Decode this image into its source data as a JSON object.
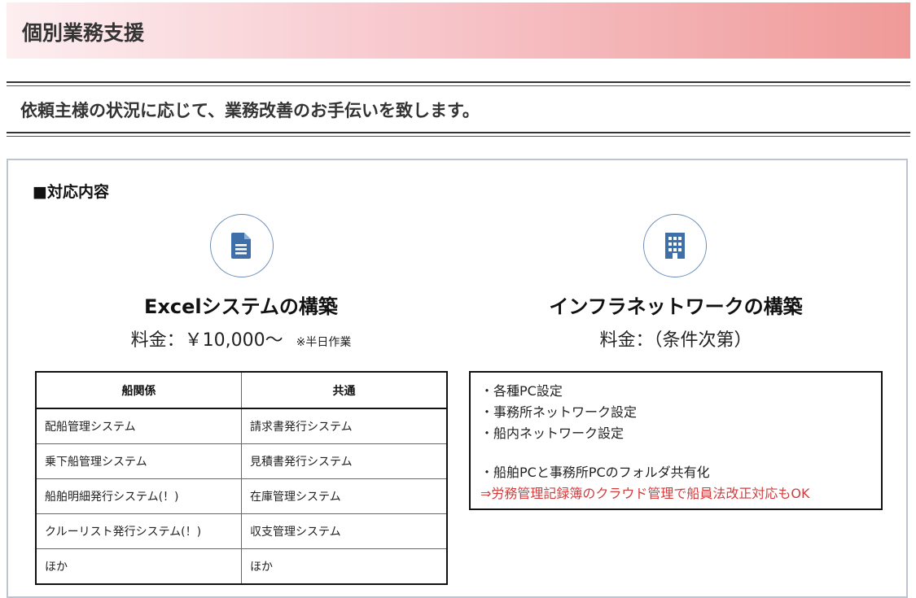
{
  "banner": {
    "title": "個別業務支援"
  },
  "lead": "依頼主様の状況に応じて、業務改善のお手伝いを致します。",
  "section_label": "■対応内容",
  "excel": {
    "icon": "document-icon",
    "title": "Excelシステムの構築",
    "price": "料金：￥10,000～",
    "price_note": "※半日作業",
    "table": {
      "headers": [
        "船関係",
        "共通"
      ],
      "rows": [
        [
          "配船管理システム",
          "請求書発行システム"
        ],
        [
          "乗下船管理システム",
          "見積書発行システム"
        ],
        [
          "船舶明細発行システム(！)",
          "在庫管理システム"
        ],
        [
          "クルーリスト発行システム(！)",
          "収支管理システム"
        ],
        [
          "ほか",
          "ほか"
        ]
      ]
    }
  },
  "infra": {
    "icon": "building-icon",
    "title": "インフラネットワークの構築",
    "price": "料金：（条件次第）",
    "items": [
      "・各種PC設定",
      "・事務所ネットワーク設定",
      "・船内ネットワーク設定"
    ],
    "items2": [
      "・船舶PCと事務所PCのフォルダ共有化"
    ],
    "highlight": "⇒労務管理記録簿のクラウド管理で船員法改正対応もOK"
  },
  "colors": {
    "accent_red": "#d23c3c",
    "icon_blue": "#3f6fa8"
  }
}
